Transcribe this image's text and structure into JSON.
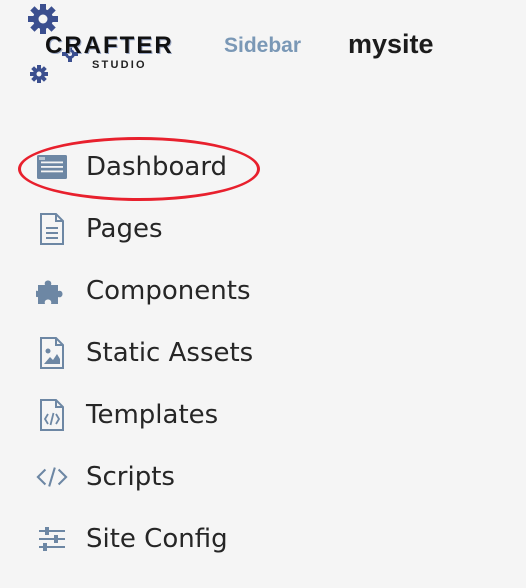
{
  "header": {
    "logo": {
      "name": "CRAFTER",
      "subname": "STUDIO",
      "icon": "gear-icon"
    },
    "sidebar_label": "Sidebar",
    "site_name": "mysite"
  },
  "nav": {
    "items": [
      {
        "label": "Dashboard",
        "icon": "dashboard-icon",
        "highlighted": true
      },
      {
        "label": "Pages",
        "icon": "page-icon"
      },
      {
        "label": "Components",
        "icon": "puzzle-icon"
      },
      {
        "label": "Static Assets",
        "icon": "image-file-icon"
      },
      {
        "label": "Templates",
        "icon": "code-file-icon"
      },
      {
        "label": "Scripts",
        "icon": "code-icon"
      },
      {
        "label": "Site Config",
        "icon": "sliders-icon"
      }
    ]
  },
  "colors": {
    "icon": "#6d87a4",
    "highlight": "#e8202d",
    "sidebar_label": "#7a98b6",
    "background": "#f5f5f5"
  }
}
